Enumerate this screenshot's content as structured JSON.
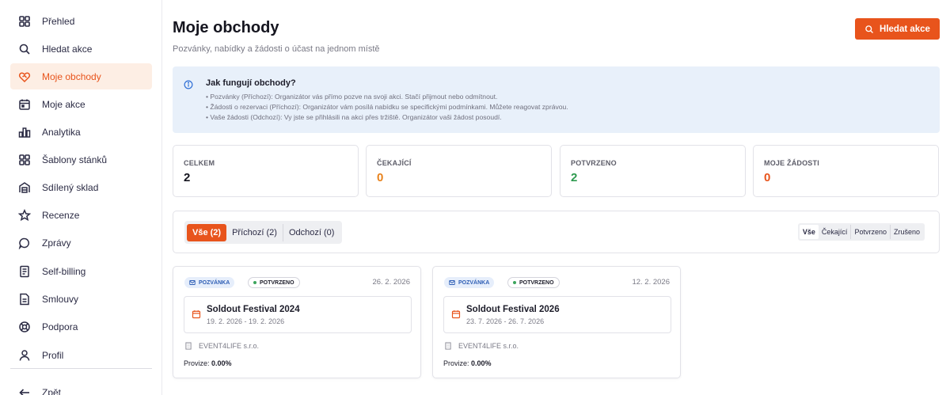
{
  "sidebar": {
    "items": [
      {
        "label": "Přehled",
        "icon": "grid-icon"
      },
      {
        "label": "Hledat akce",
        "icon": "search-icon"
      },
      {
        "label": "Moje obchody",
        "icon": "handshake-icon",
        "active": true
      },
      {
        "label": "Moje akce",
        "icon": "calendar-icon"
      },
      {
        "label": "Analytika",
        "icon": "bar-chart-icon"
      },
      {
        "label": "Šablony stánků",
        "icon": "grid-icon"
      },
      {
        "label": "Sdílený sklad",
        "icon": "warehouse-icon"
      },
      {
        "label": "Recenze",
        "icon": "star-icon"
      },
      {
        "label": "Zprávy",
        "icon": "chat-icon"
      },
      {
        "label": "Self-billing",
        "icon": "receipt-icon"
      },
      {
        "label": "Smlouvy",
        "icon": "document-icon"
      },
      {
        "label": "Podpora",
        "icon": "lifebuoy-icon"
      },
      {
        "label": "Profil",
        "icon": "user-icon"
      }
    ],
    "back_label": "Zpět"
  },
  "header": {
    "title": "Moje obchody",
    "subtitle": "Pozvánky, nabídky a žádosti o účast na jednom místě",
    "search_button": "Hledat akce"
  },
  "info": {
    "title": "Jak fungují obchody?",
    "lines": [
      "• Pozvánky (Příchozí): Organizátor vás přímo pozve na svoji akci. Stačí přijmout nebo odmítnout.",
      "• Žádosti o rezervaci (Příchozí): Organizátor vám posílá nabídku se specifickými podmínkami. Můžete reagovat zprávou.",
      "• Vaše žádosti (Odchozí): Vy jste se přihlásili na akci přes tržiště. Organizátor vaši žádost posoudí."
    ]
  },
  "stats": [
    {
      "label": "CELKEM",
      "value": "2",
      "color": "#15151f"
    },
    {
      "label": "ČEKAJÍCÍ",
      "value": "0",
      "color": "#e8821c"
    },
    {
      "label": "POTVRZENO",
      "value": "2",
      "color": "#2e9a4f"
    },
    {
      "label": "MOJE ŽÁDOSTI",
      "value": "0",
      "color": "#e8541c"
    }
  ],
  "direction_tabs": [
    {
      "label": "Vše (2)",
      "active": true
    },
    {
      "label": "Příchozí (2)"
    },
    {
      "label": "Odchozí (0)"
    }
  ],
  "status_tabs": [
    {
      "label": "Vše",
      "active": true
    },
    {
      "label": "Čekající"
    },
    {
      "label": "Potvrzeno"
    },
    {
      "label": "Zrušeno"
    }
  ],
  "deals": [
    {
      "type_badge": "POZVÁNKA",
      "status_badge": "POTVRZENO",
      "date": "26. 2. 2026",
      "event_name": "Soldout Festival 2024",
      "event_dates": "19. 2. 2026 - 19. 2. 2026",
      "organizer": "EVENT4LIFE s.r.o.",
      "commission_label": "Provize:",
      "commission_value": "0.00%"
    },
    {
      "type_badge": "POZVÁNKA",
      "status_badge": "POTVRZENO",
      "date": "12. 2. 2026",
      "event_name": "Soldout Festival 2026",
      "event_dates": "23. 7. 2026 - 26. 7. 2026",
      "organizer": "EVENT4LIFE s.r.o.",
      "commission_label": "Provize:",
      "commission_value": "0.00%"
    }
  ],
  "colors": {
    "accent": "#e8541c",
    "info_bg": "#e8f0fa",
    "active_nav_bg": "#fdeee4"
  }
}
